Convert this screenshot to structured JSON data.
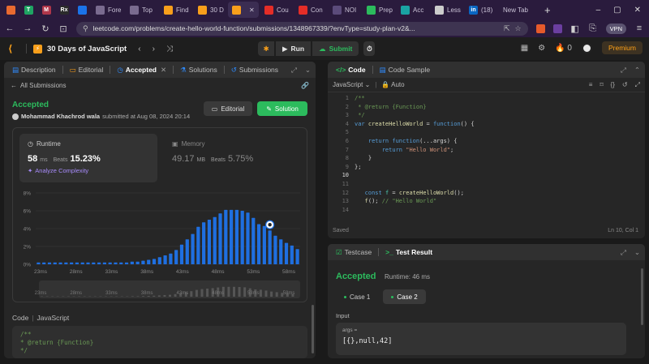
{
  "browser": {
    "tabs": [
      {
        "label": "",
        "kind": "pinned",
        "color": "#e96a30",
        "glyph": ""
      },
      {
        "label": "",
        "kind": "pinned",
        "color": "#1fa463",
        "glyph": "T"
      },
      {
        "label": "",
        "kind": "pinned",
        "color": "#b0374a",
        "glyph": "M"
      },
      {
        "label": "",
        "kind": "pinned",
        "color": "#2b2b2b",
        "glyph": "Rx"
      },
      {
        "label": "",
        "kind": "pinned",
        "color": "#1b73e8",
        "glyph": ""
      },
      {
        "label": "Fore",
        "kind": "mini",
        "color": "#7a6b8f",
        "glyph": ""
      },
      {
        "label": "Top",
        "kind": "mini",
        "color": "#7a6b8f",
        "glyph": ""
      },
      {
        "label": "Find",
        "kind": "mini",
        "color": "#f89f1b",
        "glyph": ""
      },
      {
        "label": "30 D",
        "kind": "mini",
        "color": "#f89f1b",
        "glyph": ""
      },
      {
        "label": "",
        "kind": "active",
        "color": "#f89f1b",
        "glyph": ""
      },
      {
        "label": "Cou",
        "kind": "mini",
        "color": "#e52d27",
        "glyph": ""
      },
      {
        "label": "Con",
        "kind": "mini",
        "color": "#e52d27",
        "glyph": ""
      },
      {
        "label": "NOI",
        "kind": "mini",
        "color": "#5b4b7a",
        "glyph": ""
      },
      {
        "label": "Prep",
        "kind": "mini",
        "color": "#2cbb5d",
        "glyph": ""
      },
      {
        "label": "Acc",
        "kind": "mini",
        "color": "#1aa3a3",
        "glyph": ""
      },
      {
        "label": "Less",
        "kind": "mini",
        "color": "#cccccc",
        "glyph": ""
      },
      {
        "label": "(18)",
        "kind": "mini",
        "color": "#0a66c2",
        "glyph": "in"
      },
      {
        "label": "New Tab",
        "kind": "newtab",
        "color": "",
        "glyph": ""
      }
    ],
    "url": "leetcode.com/problems/create-hello-world-function/submissions/1348967339/?envType=study-plan-v2&...",
    "vpn_label": "VPN"
  },
  "leetcode": {
    "study_plan_title": "30 Days of JavaScript",
    "run_label": "Run",
    "submit_label": "Submit",
    "premium_label": "Premium",
    "notification_count": "0"
  },
  "left_panel": {
    "tabs": [
      {
        "label": "Description",
        "active": false
      },
      {
        "label": "Editorial",
        "active": false
      },
      {
        "label": "Accepted",
        "active": true
      },
      {
        "label": "Solutions",
        "active": false
      },
      {
        "label": "Submissions",
        "active": false
      }
    ],
    "all_submissions_label": "All Submissions",
    "status": "Accepted",
    "author": "Mohammad Khachrod wala",
    "submitted_text": "submitted at Aug 08, 2024 20:14",
    "editorial_button": "Editorial",
    "solution_button": "Solution",
    "runtime": {
      "label": "Runtime",
      "value": "58",
      "unit": "ms",
      "beats_label": "Beats",
      "beats_pct": "15.23%",
      "analyze_label": "Analyze Complexity"
    },
    "memory": {
      "label": "Memory",
      "value": "49.17",
      "unit": "MB",
      "beats_label": "Beats",
      "beats_pct": "5.75%"
    },
    "code_header": {
      "label": "Code",
      "language": "JavaScript"
    },
    "snippet_lines": [
      "/**",
      " * @return {Function}",
      " */"
    ]
  },
  "chart_data": {
    "type": "bar",
    "title": "",
    "xlabel": "",
    "ylabel": "",
    "ylim": [
      0,
      8
    ],
    "y_ticks": [
      "0%",
      "2%",
      "4%",
      "6%",
      "8%"
    ],
    "x_tick_labels": [
      "23ms",
      "28ms",
      "33ms",
      "38ms",
      "43ms",
      "48ms",
      "53ms",
      "58ms"
    ],
    "grid": true,
    "values": [
      0.2,
      0.2,
      0.2,
      0.2,
      0.2,
      0.2,
      0.2,
      0.2,
      0.2,
      0.2,
      0.2,
      0.2,
      0.2,
      0.2,
      0.2,
      0.2,
      0.2,
      0.3,
      0.3,
      0.4,
      0.5,
      0.6,
      0.8,
      1.0,
      1.2,
      1.6,
      2.2,
      2.8,
      3.4,
      4.2,
      4.7,
      5.0,
      5.3,
      5.7,
      6.1,
      6.1,
      6.1,
      6.0,
      5.8,
      5.2,
      4.5,
      4.3,
      3.8,
      3.2,
      2.8,
      2.4,
      2.1,
      1.7
    ],
    "highlight_index": 42,
    "bar_color": "#1f6fe0"
  },
  "editor": {
    "tab_code": "Code",
    "tab_sample": "Code Sample",
    "language": "JavaScript",
    "mode": "Auto",
    "saved_label": "Saved",
    "cursor_position": "Ln 10, Col 1",
    "lines": [
      {
        "n": "1",
        "tokens": [
          [
            "cm",
            "/**"
          ]
        ]
      },
      {
        "n": "2",
        "tokens": [
          [
            "cm",
            " * @return {Function}"
          ]
        ]
      },
      {
        "n": "3",
        "tokens": [
          [
            "cm",
            " */"
          ]
        ]
      },
      {
        "n": "4",
        "tokens": [
          [
            "kw",
            "var "
          ],
          [
            "fn",
            "createHelloWorld"
          ],
          [
            "pn",
            " = "
          ],
          [
            "kw",
            "function"
          ],
          [
            "pn",
            "() {"
          ]
        ]
      },
      {
        "n": "5",
        "tokens": [
          [
            "pn",
            ""
          ]
        ]
      },
      {
        "n": "6",
        "tokens": [
          [
            "pn",
            "    "
          ],
          [
            "kw",
            "return "
          ],
          [
            "kw",
            "function"
          ],
          [
            "pn",
            "(...args) {"
          ]
        ]
      },
      {
        "n": "7",
        "tokens": [
          [
            "pn",
            "        "
          ],
          [
            "kw",
            "return "
          ],
          [
            "str",
            "\"Hello World\""
          ],
          [
            "pn",
            ";"
          ]
        ]
      },
      {
        "n": "8",
        "tokens": [
          [
            "pn",
            "    }"
          ]
        ]
      },
      {
        "n": "9",
        "tokens": [
          [
            "pn",
            "};"
          ]
        ]
      },
      {
        "n": "10",
        "tokens": [
          [
            "pn",
            ""
          ]
        ]
      },
      {
        "n": "11",
        "tokens": [
          [
            "pn",
            ""
          ]
        ]
      },
      {
        "n": "12",
        "tokens": [
          [
            "pn",
            "   "
          ],
          [
            "kw",
            "const "
          ],
          [
            "ty",
            "f"
          ],
          [
            "pn",
            " = "
          ],
          [
            "fn",
            "createHelloWorld"
          ],
          [
            "pn",
            "();"
          ]
        ]
      },
      {
        "n": "13",
        "tokens": [
          [
            "pn",
            "   "
          ],
          [
            "fn",
            "f"
          ],
          [
            "pn",
            "(); "
          ],
          [
            "cm",
            "// \"Hello World\""
          ]
        ]
      },
      {
        "n": "14",
        "tokens": [
          [
            "pn",
            ""
          ]
        ]
      }
    ],
    "current_line": "10"
  },
  "test_panel": {
    "tab_testcase": "Testcase",
    "tab_result": "Test Result",
    "status": "Accepted",
    "runtime_text": "Runtime: 46 ms",
    "cases": [
      {
        "label": "Case 1",
        "active": false
      },
      {
        "label": "Case 2",
        "active": true
      }
    ],
    "input_label": "Input",
    "input_name": "args =",
    "input_value": "[{},null,42]"
  }
}
